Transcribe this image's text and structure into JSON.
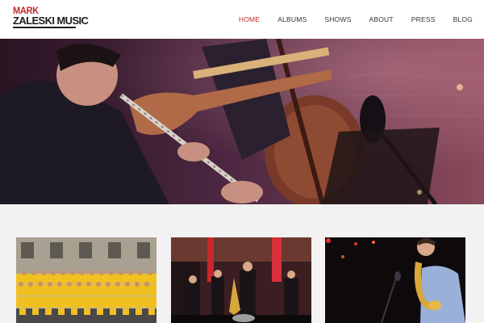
{
  "site": {
    "logo_line1": "MARK",
    "logo_line2": "ZALESKI MUSIC"
  },
  "nav": {
    "items": [
      {
        "label": "HOME",
        "active": true
      },
      {
        "label": "ALBUMS",
        "active": false
      },
      {
        "label": "SHOWS",
        "active": false
      },
      {
        "label": "ABOUT",
        "active": false
      },
      {
        "label": "PRESS",
        "active": false
      },
      {
        "label": "BLOG",
        "active": false
      }
    ]
  },
  "colors": {
    "accent": "#c0282d",
    "text": "#333333",
    "content_bg": "#f2f2f2"
  },
  "hero": {
    "subject": "saxophonist performing with band"
  },
  "cards": [
    {
      "subject": "choir group photo"
    },
    {
      "subject": "band performing on stage"
    },
    {
      "subject": "saxophonist at microphone"
    }
  ]
}
